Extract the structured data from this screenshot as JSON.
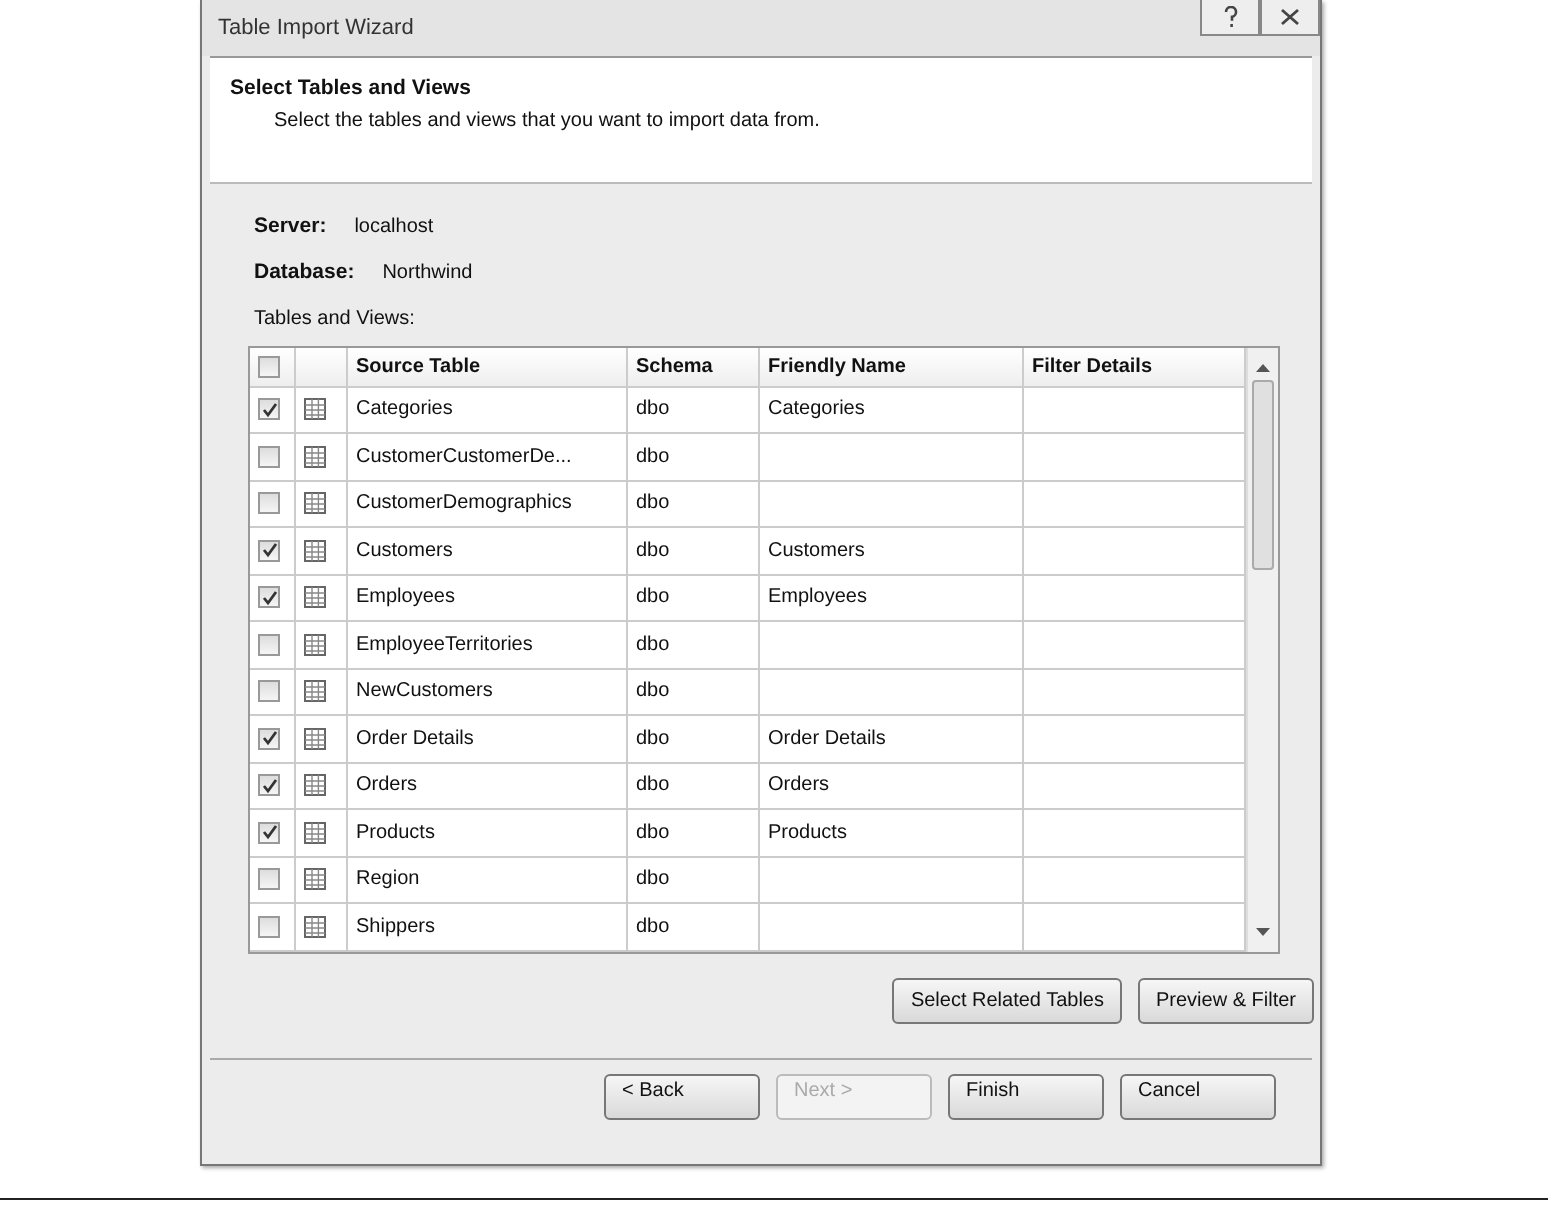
{
  "window": {
    "title": "Table Import Wizard"
  },
  "header": {
    "title": "Select Tables and Views",
    "subtitle": "Select the tables and views that you want to import data from."
  },
  "fields": [
    {
      "label": "Server:",
      "value": "localhost"
    },
    {
      "label": "Database:",
      "value": "Northwind"
    }
  ],
  "tables_label": "Tables and Views:",
  "table": {
    "select_all": {
      "checked": false
    },
    "columns": [
      "Source Table",
      "Schema",
      "Friendly Name",
      "Filter Details"
    ],
    "rows": [
      {
        "checked": true,
        "source": "Categories",
        "schema": "dbo",
        "friendly": "Categories"
      },
      {
        "checked": false,
        "source": "CustomerCustomerDe...",
        "schema": "dbo"
      },
      {
        "checked": false,
        "source": "CustomerDemographics",
        "schema": "dbo"
      },
      {
        "checked": true,
        "source": "Customers",
        "schema": "dbo",
        "friendly": "Customers"
      },
      {
        "checked": true,
        "source": "Employees",
        "schema": "dbo",
        "friendly": "Employees"
      },
      {
        "checked": false,
        "source": "EmployeeTerritories",
        "schema": "dbo"
      },
      {
        "checked": false,
        "source": "NewCustomers",
        "schema": "dbo"
      },
      {
        "checked": true,
        "source": "Order Details",
        "schema": "dbo",
        "friendly": "Order Details"
      },
      {
        "checked": true,
        "source": "Orders",
        "schema": "dbo",
        "friendly": "Orders"
      },
      {
        "checked": true,
        "source": "Products",
        "schema": "dbo",
        "friendly": "Products"
      },
      {
        "checked": false,
        "source": "Region",
        "schema": "dbo"
      },
      {
        "checked": false,
        "source": "Shippers",
        "schema": "dbo"
      }
    ]
  },
  "table_buttons": [
    {
      "label": "Select Related Tables"
    },
    {
      "label": "Preview & Filter"
    }
  ],
  "nav_buttons": [
    {
      "label": "< Back",
      "disabled": false
    },
    {
      "label": "Next >",
      "disabled": true
    },
    {
      "label": "Finish",
      "disabled": false
    },
    {
      "label": "Cancel",
      "disabled": false
    }
  ]
}
